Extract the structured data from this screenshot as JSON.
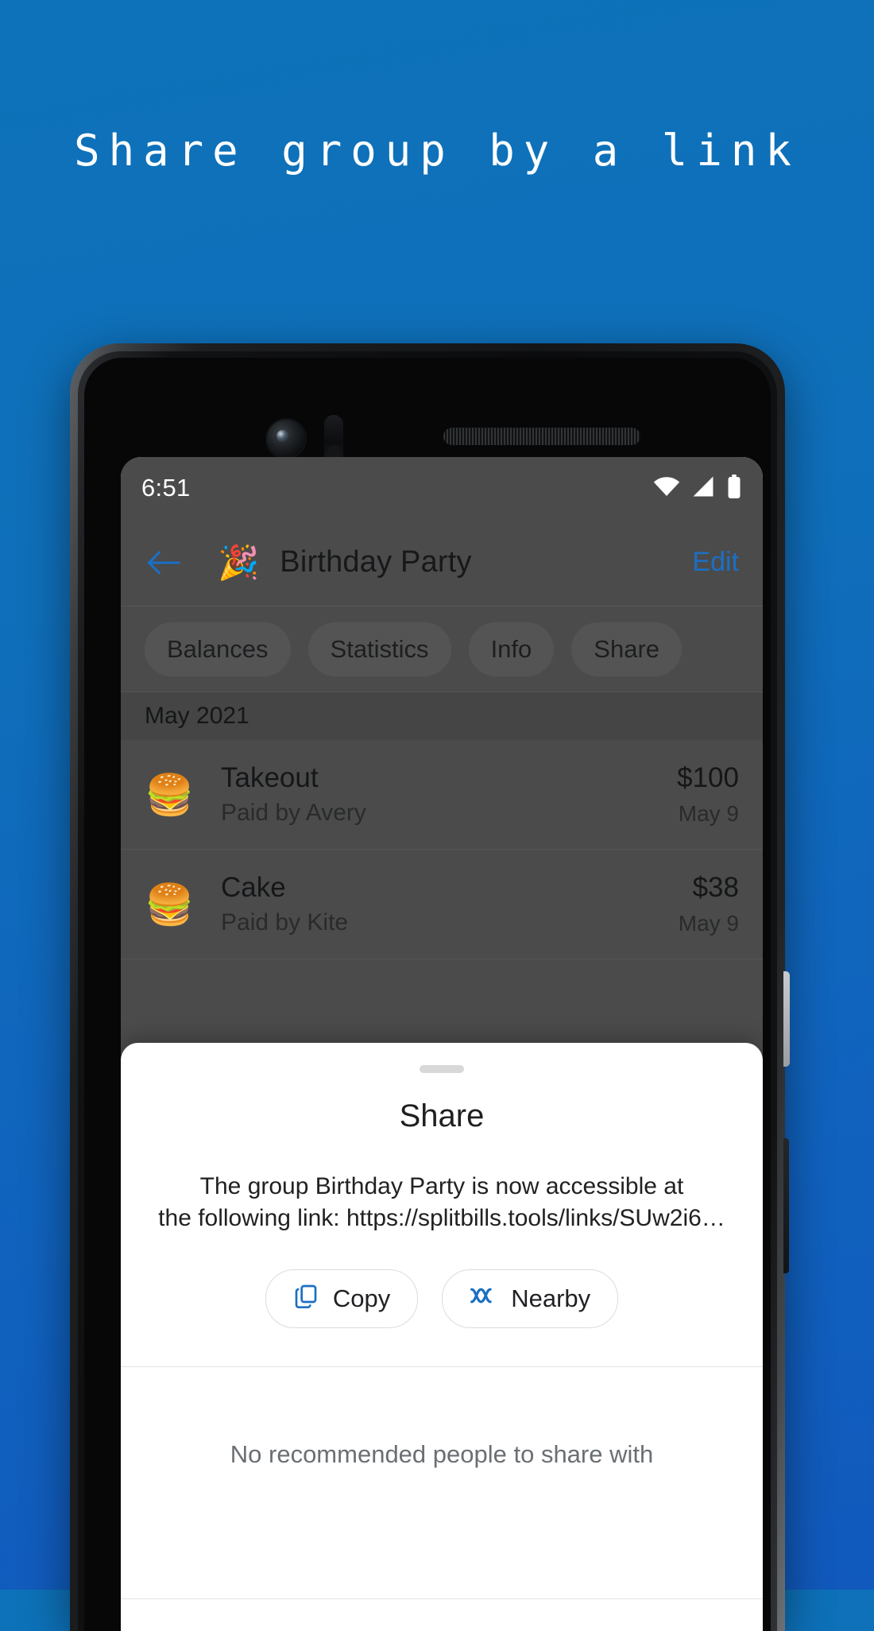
{
  "promo": {
    "headline": "Share group by a link",
    "background_color": "#0f6bba"
  },
  "phone": {
    "status_bar": {
      "time": "6:51",
      "icons": [
        "wifi-icon",
        "cellular-signal-icon",
        "battery-icon"
      ]
    },
    "app_bar": {
      "back_icon": "back-arrow-icon",
      "group_emoji": "🎉",
      "group_title": "Birthday Party",
      "edit_label": "Edit",
      "accent_color": "#1b6fc4"
    },
    "chips": [
      {
        "label": "Balances"
      },
      {
        "label": "Statistics"
      },
      {
        "label": "Info"
      },
      {
        "label": "Share"
      }
    ],
    "month_header": "May 2021",
    "expenses": [
      {
        "emoji": "🍔",
        "title": "Takeout",
        "subtitle": "Paid by Avery",
        "amount": "$100",
        "date": "May 9"
      },
      {
        "emoji": "🍔",
        "title": "Cake",
        "subtitle": "Paid by Kite",
        "amount": "$38",
        "date": "May 9"
      }
    ]
  },
  "share_sheet": {
    "handle": "drag-handle",
    "title": "Share",
    "description": "The group Birthday Party is now accessible at\nthe following link: https://splitbills.tools/links/SUw2i6…",
    "actions": [
      {
        "label": "Copy",
        "icon": "copy-icon"
      },
      {
        "label": "Nearby",
        "icon": "nearby-share-icon"
      }
    ],
    "empty_text": "No recommended people to share with"
  }
}
